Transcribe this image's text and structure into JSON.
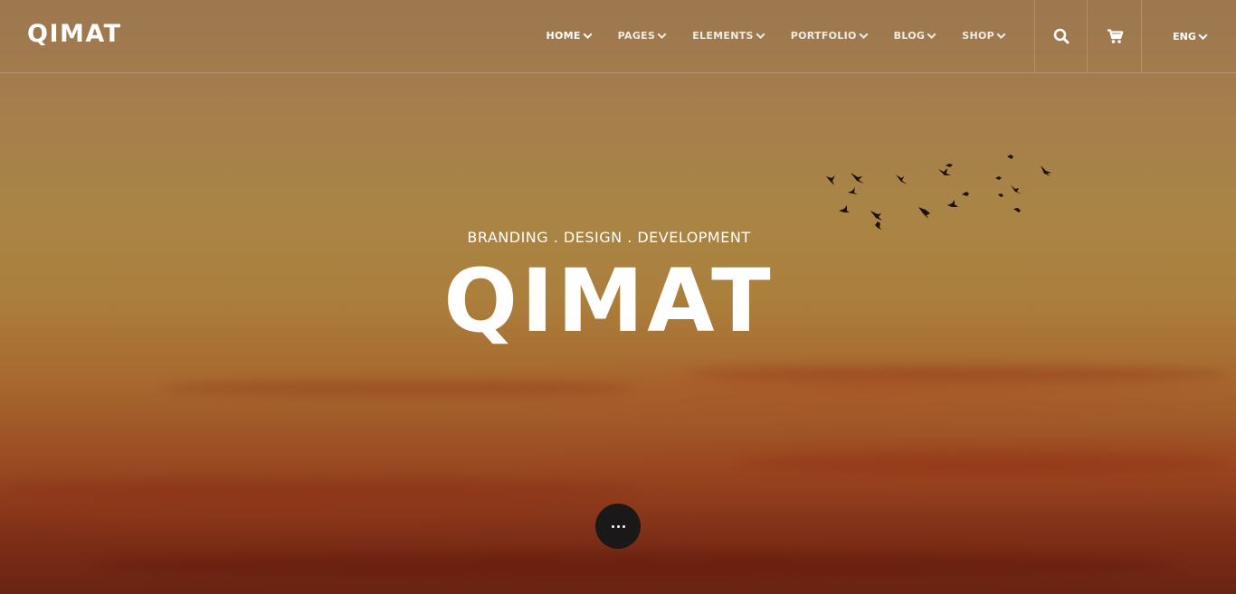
{
  "header": {
    "logo": "QIMAT",
    "nav": [
      {
        "label": "HOME",
        "active": true
      },
      {
        "label": "PAGES",
        "active": false
      },
      {
        "label": "ELEMENTS",
        "active": false
      },
      {
        "label": "PORTFOLIO",
        "active": false
      },
      {
        "label": "BLOG",
        "active": false
      },
      {
        "label": "SHOP",
        "active": false
      }
    ],
    "search_icon": "search-icon",
    "cart_icon": "cart-icon",
    "language": "ENG"
  },
  "hero": {
    "tagline": "BRANDING . DESIGN . DEVELOPMENT",
    "title": "QIMAT",
    "more_icon": "more-dots-icon"
  },
  "colors": {
    "text": "#ffffff",
    "button_bg": "#1a1818",
    "sky_top": "#9c774f",
    "sky_bottom": "#6a2313"
  }
}
